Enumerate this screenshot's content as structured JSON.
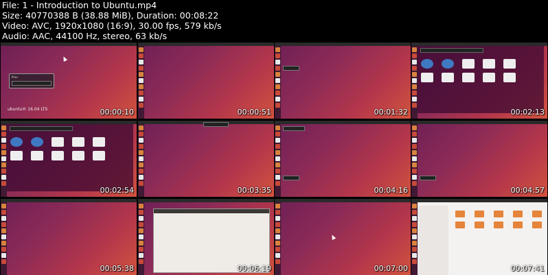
{
  "header": {
    "file_line": "File: 1 - Introduction to Ubuntu.mp4",
    "size_line": "Size: 40770388 B (38.88 MiB), Duration: 00:08:22",
    "video_line": "Video: AVC, 1920x1080 (16:9), 30.00 fps, 579 kb/s",
    "audio_line": "Audio: AAC, 44100 Hz, stereo, 63 kb/s"
  },
  "thumbnails": [
    {
      "timestamp": "00:00:10",
      "scene": "login"
    },
    {
      "timestamp": "00:00:51",
      "scene": "desktop"
    },
    {
      "timestamp": "00:01:32",
      "scene": "desktop-tooltip"
    },
    {
      "timestamp": "00:02:13",
      "scene": "dash"
    },
    {
      "timestamp": "00:02:54",
      "scene": "dash"
    },
    {
      "timestamp": "00:03:35",
      "scene": "desktop"
    },
    {
      "timestamp": "00:04:16",
      "scene": "desktop-tooltip"
    },
    {
      "timestamp": "00:04:57",
      "scene": "desktop-tooltip"
    },
    {
      "timestamp": "00:05:38",
      "scene": "desktop"
    },
    {
      "timestamp": "00:06:19",
      "scene": "settings-window"
    },
    {
      "timestamp": "00:07:00",
      "scene": "desktop-cursor"
    },
    {
      "timestamp": "00:07:41",
      "scene": "file-manager"
    }
  ],
  "thumb_text": {
    "ubuntu_logo": "ubuntu® 16.04 LTS"
  }
}
